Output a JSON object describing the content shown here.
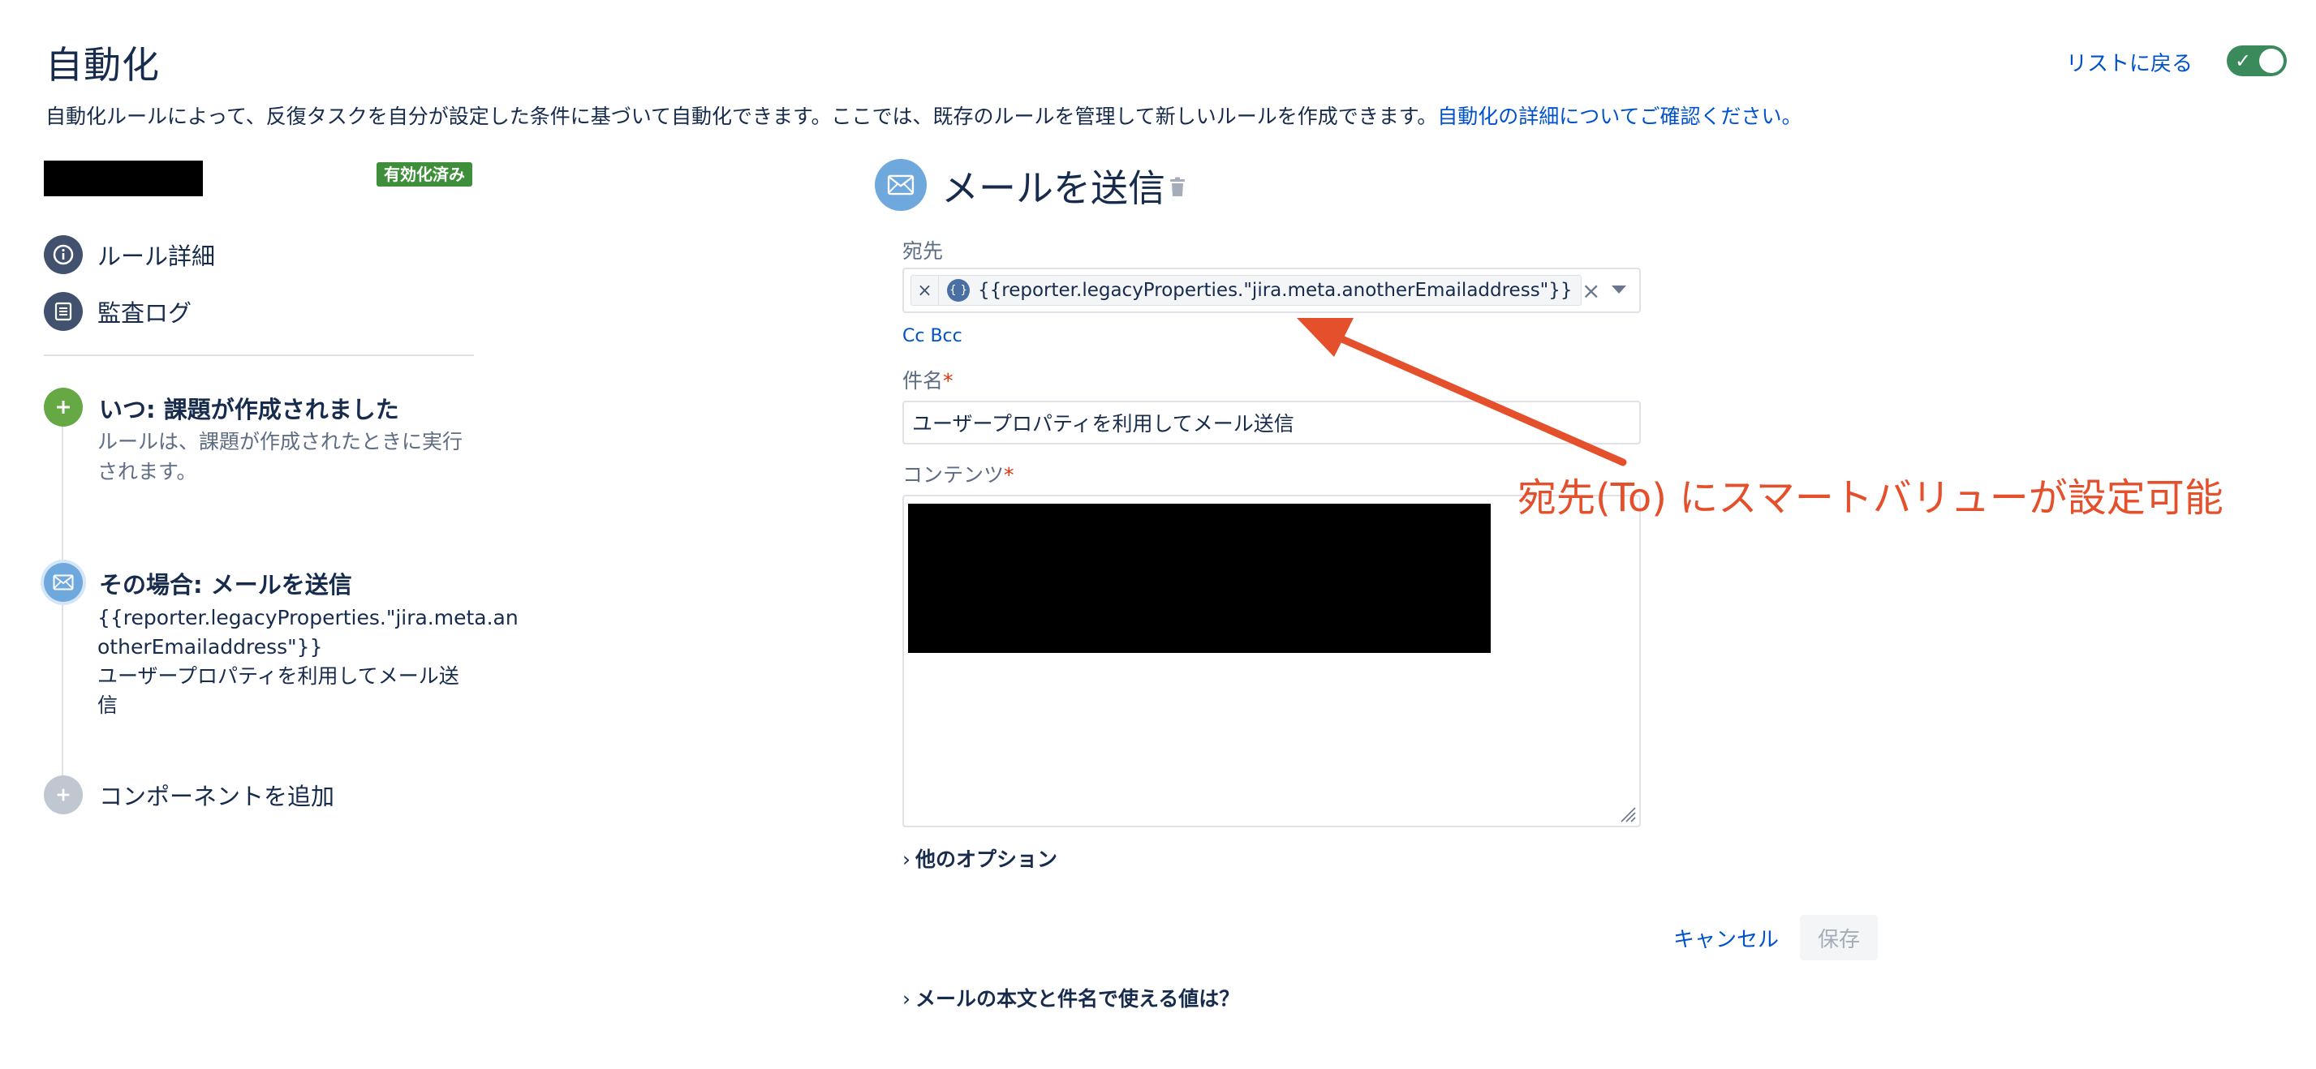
{
  "header": {
    "title": "自動化",
    "description": "自動化ルールによって、反復タスクを自分が設定した条件に基づいて自動化できます。ここでは、既存のルールを管理して新しいルールを作成できます。",
    "learn_more_link": "自動化の詳細についてご確認ください。",
    "back_to_list": "リストに戻る",
    "toggle_state": "on",
    "toggle_color": "#3a8a5c"
  },
  "sidebar": {
    "status_badge": "有効化済み",
    "rule_details": "ルール詳細",
    "audit_log": "監査ログ",
    "trigger": {
      "title": "いつ: 課題が作成されました",
      "subtitle_line1": "ルールは、課題が作成されたときに実行",
      "subtitle_line2": "されます。"
    },
    "action": {
      "title": "その場合: メールを送信",
      "line1": "{{reporter.legacyProperties.\"jira.meta.an",
      "line2": "otherEmailaddress\"}}",
      "line3": "ユーザープロパティを利用してメール送",
      "line4": "信"
    },
    "add_component": "コンポーネントを追加"
  },
  "form": {
    "action_title": "メールを送信",
    "to_label": "宛先",
    "to_chip_value": "{{reporter.legacyProperties.\"jira.meta.anotherEmailaddress\"}}",
    "cc_bcc": "Cc Bcc",
    "subject_label": "件名",
    "subject_value": "ユーザープロパティを利用してメール送信",
    "content_label": "コンテンツ",
    "required_mark": "*",
    "more_options": "他のオプション",
    "cancel": "キャンセル",
    "save": "保存",
    "help_toggle": "メールの本文と件名で使える値は？"
  },
  "annotation": {
    "text": "宛先(To) にスマートバリューが設定可能",
    "color": "#e5502c"
  },
  "icons": {
    "info": "info-icon",
    "audit": "list-icon",
    "plus": "plus-icon",
    "mail": "mail-icon",
    "trash": "trash-icon",
    "chevron": "chevron-right-icon",
    "check": "check-icon"
  }
}
